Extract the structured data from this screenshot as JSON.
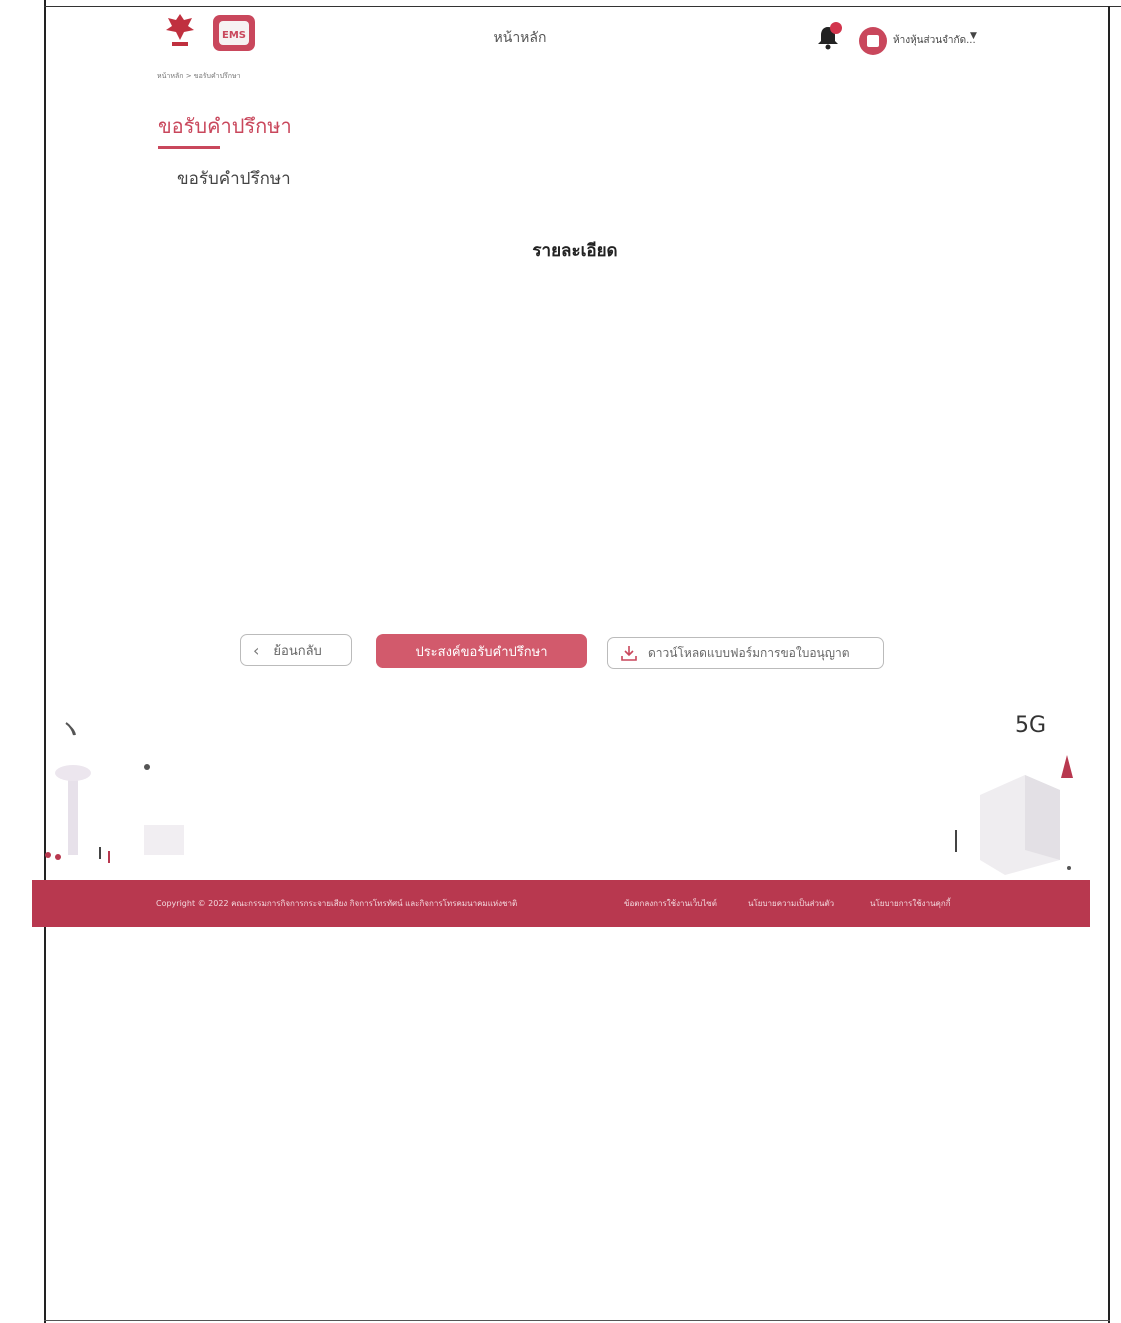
{
  "header": {
    "nav_home": "หน้าหลัก",
    "ems_logo_text": "EMS",
    "user_name": "ห้างหุ้นส่วนจำกัด...",
    "caret": "▼"
  },
  "breadcrumb": "หน้าหลัก > ขอรับคำปรึกษา",
  "page": {
    "title": "ขอรับคำปรึกษา",
    "subtitle": "ขอรับคำปรึกษา",
    "detail_heading": "รายละเอียด"
  },
  "actions": {
    "back_label": "ย้อนกลับ",
    "submit_label": "ประสงค์ขอรับคำปรึกษา",
    "download_label": "ดาวน์โหลดแบบฟอร์มการขอใบอนุญาต"
  },
  "illustration": {
    "badge_5g": "5G"
  },
  "footer": {
    "copyright": "Copyright © 2022 คณะกรรมการกิจการกระจายเสียง กิจการโทรทัศน์ และกิจการโทรคมนาคมแห่งชาติ",
    "link_terms": "ข้อตกลงการใช้งานเว็บไซต์",
    "link_privacy": "นโยบายความเป็นส่วนตัว",
    "link_cookie": "นโยบายการใช้งานคุกกี้"
  },
  "colors": {
    "brand": "#c9475c",
    "footer_bg": "#b8384f",
    "primary_button": "#d25a6c"
  }
}
